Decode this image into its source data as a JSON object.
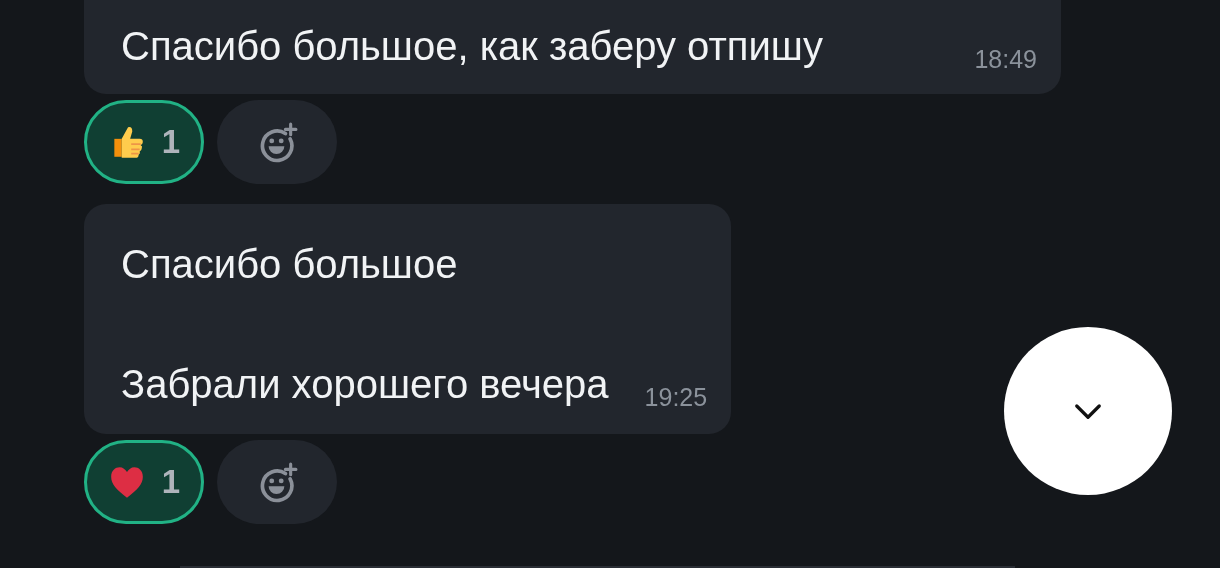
{
  "messages": [
    {
      "text": "Спасибо большое, как заберу отпишу",
      "time": "18:49",
      "reactions": [
        {
          "kind": "thumbs-up",
          "count": "1",
          "selected": true
        }
      ]
    },
    {
      "text": "Спасибо большое\n\nЗабрали хорошего вечера",
      "time": "19:25",
      "reactions": [
        {
          "kind": "heart",
          "count": "1",
          "selected": true
        }
      ]
    }
  ],
  "scroll_down_button": {
    "kind": "chevron-down"
  }
}
